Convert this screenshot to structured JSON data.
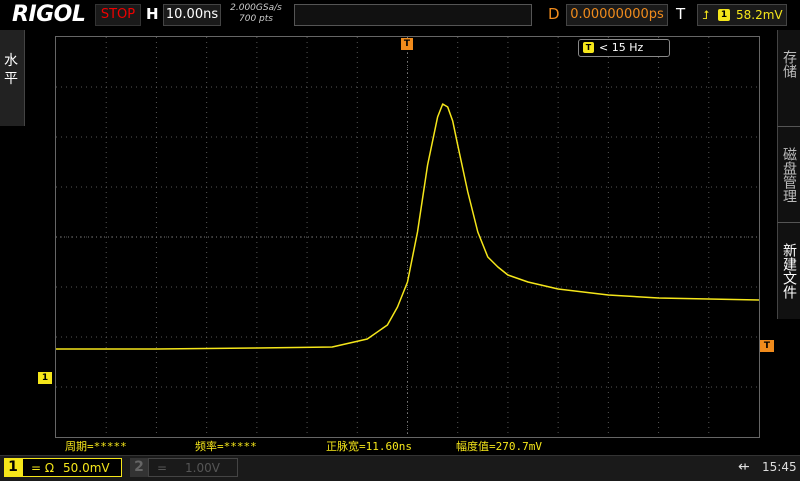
{
  "header": {
    "logo": "RIGOL",
    "status": "STOP",
    "horizontal_label": "H",
    "timebase": "10.00ns",
    "sample_rate": "2.000GSa/s",
    "memory_depth": "700 pts",
    "delay_label": "D",
    "delay": "0.00000000ps",
    "trigger_label": "T",
    "trigger_source_badge": "1",
    "trigger_level": "58.2mV"
  },
  "left_menu": {
    "label": "水平"
  },
  "right_menu": [
    {
      "label": "存储"
    },
    {
      "label": "磁盘管理"
    },
    {
      "label": "新建文件"
    }
  ],
  "frequency_counter": {
    "badge": "T",
    "value": "< 15 Hz"
  },
  "markers": {
    "ch1": "1",
    "trigger_position": "T",
    "trigger_level": "T"
  },
  "measurements": [
    {
      "text": "周期=*****"
    },
    {
      "text": "频率=*****"
    },
    {
      "text": "正脉宽=11.60ns"
    },
    {
      "text": "幅度值=270.7mV"
    }
  ],
  "channels": [
    {
      "badge": "1",
      "coupling": "= Ω",
      "scale": "50.0mV",
      "active": true
    },
    {
      "badge": "2",
      "coupling": "=",
      "scale": "1.00V",
      "active": false
    }
  ],
  "status_bar": {
    "usb_icon": "usb-icon",
    "time": "15:45"
  },
  "colors": {
    "ch1": "#f5e61a",
    "trigger": "#f08b1c",
    "stop": "#e00000"
  },
  "chart_data": {
    "type": "line",
    "title": "",
    "xlabel": "",
    "ylabel": "",
    "x_unit": "ns",
    "y_unit": "mV",
    "x_range": [
      -70,
      70
    ],
    "y_range": [
      -200,
      200
    ],
    "series": [
      {
        "x": [
          -70,
          -50,
          -30,
          -15,
          -8,
          -4,
          -2,
          0,
          2,
          4,
          6,
          7,
          8,
          9,
          10,
          12,
          14,
          16,
          18,
          20,
          24,
          30,
          40,
          50,
          60,
          70
        ],
        "y": [
          -112,
          -112,
          -111,
          -110,
          -102,
          -88,
          -70,
          -45,
          5,
          72,
          120,
          133,
          130,
          116,
          92,
          45,
          5,
          -20,
          -30,
          -38,
          -45,
          -52,
          -58,
          -61,
          -62,
          -63
        ]
      }
    ]
  }
}
